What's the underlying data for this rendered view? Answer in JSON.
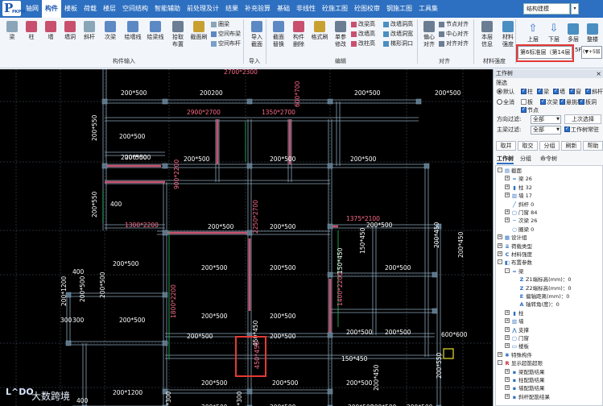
{
  "app": {
    "logo_text": "P",
    "logo_sub": "PKPM"
  },
  "menu": {
    "tabs": [
      "轴网",
      "构件",
      "楼板",
      "荷载",
      "楼层",
      "空间结构",
      "智能辅助",
      "前处理及计",
      "结果",
      "补充验算",
      "基础",
      "非线性",
      "砼施工图",
      "砼图校审",
      "钢施工图",
      "工具集"
    ],
    "active_tab": "构件",
    "search_value": "结构建模",
    "search_arrow": "▾"
  },
  "ribbon": {
    "buttons": [
      {
        "label": "梁",
        "icon": "beam-icon"
      },
      {
        "label": "柱",
        "icon": "column-icon"
      },
      {
        "label": "墙",
        "icon": "wall-icon"
      },
      {
        "label": "墙洞",
        "icon": "wall-opening-icon"
      },
      {
        "label": "斜杆",
        "icon": "brace-icon"
      },
      {
        "label": "次梁",
        "icon": "secondary-beam-icon"
      },
      {
        "label": "绘墙线",
        "icon": "draw-wall-line-icon"
      },
      {
        "label": "绘梁线",
        "icon": "draw-beam-line-icon"
      },
      {
        "label": "拾取",
        "label2": "布置",
        "icon": "pick-place-icon"
      },
      {
        "label": "截面刷",
        "icon": "section-brush-icon"
      },
      {
        "label": "导入",
        "label2": "截面",
        "icon": "import-section-icon"
      },
      {
        "label": "截面",
        "label2": "替换",
        "icon": "section-replace-icon"
      },
      {
        "label": "构件",
        "label2": "删除",
        "icon": "component-delete-icon"
      },
      {
        "label": "格式刷",
        "icon": "format-brush-icon"
      },
      {
        "label": "单参",
        "label2": "修改",
        "icon": "single-param-edit-icon"
      },
      {
        "label": "偏心",
        "label2": "对齐",
        "icon": "eccentric-align-icon"
      },
      {
        "label": "本层",
        "label2": "信息",
        "icon": "floor-info-icon"
      },
      {
        "label": "材料",
        "label2": "强度",
        "icon": "material-strength-icon"
      },
      {
        "label": "上层",
        "icon": "floor-up-icon"
      },
      {
        "label": "下层",
        "icon": "floor-down-icon"
      },
      {
        "label": "多层",
        "icon": "multi-floor-icon"
      },
      {
        "label": "整楼",
        "icon": "whole-building-icon"
      }
    ],
    "small_buttons": {
      "ring_beam": "圈梁",
      "space_beam": "空间布梁",
      "space_rod": "空间布杆",
      "change_beam_ht": "改梁高",
      "change_wall_ht": "改墙高",
      "change_col_ht": "改柱高",
      "change_opening_ht": "改墙洞高",
      "change_opening_wd": "改墙洞宽",
      "trapezoid": "梯形洞口",
      "node_align": "节点对齐",
      "center_align": "中心对齐",
      "edge_align": "对齐对齐"
    },
    "groups": {
      "component_input": "构件输入",
      "import": "导入",
      "edit": "编辑",
      "align": "对齐",
      "material_strength": "材料强度"
    },
    "floor_selector": "第6标准层（第14层",
    "floor_level": "5F",
    "floor_combo": "(▼+5层"
  },
  "canvas": {
    "dimension_labels": [
      "2700*2300",
      "200*500",
      "200*500",
      "200*500",
      "600*700",
      "200*500",
      "200*500",
      "200*500",
      "200200",
      "200*500",
      "2900*2700",
      "1350*2700",
      "200*550",
      "200*550",
      "200*450",
      "900*2200",
      "400",
      "200*500",
      "200*500",
      "200*500",
      "1300*2200",
      "200*500",
      "200*500",
      "2250*2700",
      "1375*2100",
      "200*500",
      "200*500",
      "150*450",
      "400",
      "150*450",
      "200*500",
      "200*500",
      "200*500",
      "200*500",
      "200*450",
      "1400*2200",
      "300",
      "200*1200",
      "200*500",
      "200*500",
      "1800*2200",
      "200*500",
      "200*500",
      "200*500",
      "450*450",
      "200*500",
      "200*500",
      "150*450",
      "200*500",
      "200*500",
      "200*1200",
      "200*500",
      "200*500",
      "200*500",
      "200*450",
      "200*500",
      "200*500",
      "200*500",
      "400",
      "300",
      "200*550",
      "600*600",
      "200*1200",
      "200*500",
      "200*500",
      "200*300",
      "200*300",
      "200*500",
      "200*500",
      "200*500"
    ],
    "highlight_label": "450*450"
  },
  "panel": {
    "title": "工作树",
    "close": "×",
    "filter_label": "筛选",
    "radio_default": "默认",
    "radio_all": "全消",
    "checks_row1": [
      "柱",
      "梁",
      "墙",
      "窗",
      "斜杆"
    ],
    "checks_row2": [
      "板",
      "次梁",
      "悬挑板",
      "板洞"
    ],
    "checks_row3": [
      "节点"
    ],
    "direction_filter_label": "方向过滤:",
    "direction_filter_value": "全部",
    "prev_select_button": "上次选择",
    "main_beam_filter_label": "主梁过滤:",
    "main_beam_filter_value": "全部",
    "tree_pin_label": "工作树常驻",
    "buttons": [
      "取并",
      "取交",
      "分组",
      "刷新",
      "帮助"
    ],
    "tabs": [
      "工作树",
      "分组",
      "命令树"
    ],
    "active_tab": "工作树"
  },
  "tree": {
    "nodes": [
      {
        "label": "截面",
        "depth": 0,
        "toggle": "-",
        "icon": "section-icon"
      },
      {
        "label": "梁 26",
        "depth": 1,
        "toggle": "+",
        "icon": "beam-icon"
      },
      {
        "label": "柱 32",
        "depth": 1,
        "toggle": "+",
        "icon": "column-icon"
      },
      {
        "label": "墙 17",
        "depth": 1,
        "toggle": "+",
        "icon": "wall-icon"
      },
      {
        "label": "斜杆 0",
        "depth": 1,
        "toggle": "",
        "icon": "brace-icon"
      },
      {
        "label": "门窗 84",
        "depth": 1,
        "toggle": "+",
        "icon": "door-window-icon"
      },
      {
        "label": "次梁 26",
        "depth": 1,
        "toggle": "+",
        "icon": "secondary-beam-icon"
      },
      {
        "label": "圈梁 0",
        "depth": 1,
        "toggle": "",
        "icon": "ring-beam-icon"
      },
      {
        "label": "设计组",
        "depth": 0,
        "toggle": "+",
        "icon": "design-group-icon"
      },
      {
        "label": "荷载类型",
        "depth": 0,
        "toggle": "+",
        "icon": "load-type-icon"
      },
      {
        "label": "材料强度",
        "depth": 0,
        "toggle": "+",
        "icon": "material-icon"
      },
      {
        "label": "布置参数",
        "depth": 0,
        "toggle": "-",
        "icon": "layout-params-icon"
      },
      {
        "label": "梁",
        "depth": 1,
        "toggle": "-",
        "icon": "beam-icon"
      },
      {
        "label": "Z1端标高(mm)：0",
        "depth": 2,
        "toggle": "",
        "icon": "z1-icon"
      },
      {
        "label": "Z2端标高(mm)：0",
        "depth": 2,
        "toggle": "",
        "icon": "z2-icon"
      },
      {
        "label": "偏轴距离(mm)：0",
        "depth": 2,
        "toggle": "",
        "icon": "offset-icon"
      },
      {
        "label": "轴转角(度)：0",
        "depth": 2,
        "toggle": "",
        "icon": "angle-icon"
      },
      {
        "label": "柱",
        "depth": 1,
        "toggle": "+",
        "icon": "column-icon"
      },
      {
        "label": "墙",
        "depth": 1,
        "toggle": "+",
        "icon": "wall-icon"
      },
      {
        "label": "支撑",
        "depth": 1,
        "toggle": "+",
        "icon": "support-icon"
      },
      {
        "label": "门窗",
        "depth": 1,
        "toggle": "+",
        "icon": "door-window-icon"
      },
      {
        "label": "楼板",
        "depth": 1,
        "toggle": "+",
        "icon": "slab-icon"
      },
      {
        "label": "特殊构件",
        "depth": 0,
        "toggle": "+",
        "icon": "special-component-icon"
      },
      {
        "label": "显示超筋超限",
        "depth": 0,
        "toggle": "-",
        "icon": "over-limit-icon"
      },
      {
        "label": "梁配筋结果",
        "depth": 1,
        "toggle": "+",
        "icon": "beam-rebar-icon"
      },
      {
        "label": "柱配筋结果",
        "depth": 1,
        "toggle": "+",
        "icon": "column-rebar-icon"
      },
      {
        "label": "墙配筋结果",
        "depth": 1,
        "toggle": "+",
        "icon": "wall-rebar-icon"
      },
      {
        "label": "斜杆配筋结果",
        "depth": 1,
        "toggle": "+",
        "icon": "brace-rebar-icon"
      }
    ]
  },
  "watermark": {
    "mark": "L^DO",
    "text": "大数跨境"
  },
  "colors": {
    "menu_bg": "#2d6fc0",
    "canvas_bg": "#000000",
    "beam": "#8aa4b8",
    "beam_fill": "#5a7488",
    "dimension_text": "#ffffff",
    "opening_text": "#ff6b8a",
    "wall": "#c8506e",
    "column_green": "#22c55e",
    "highlight": "#e53935",
    "selected_column": "#e8e030"
  }
}
